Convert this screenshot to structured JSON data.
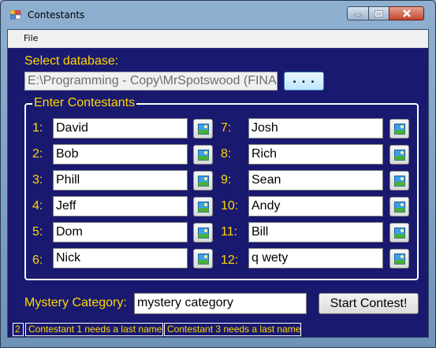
{
  "window": {
    "title": "Contestants"
  },
  "menu": {
    "file": "File"
  },
  "database": {
    "label": "Select database:",
    "path": "E:\\Programming - Copy\\MrSpotswood (FINA",
    "browse_label": ". . ."
  },
  "contestants": {
    "group_title": "Enter Contestants",
    "left": [
      {
        "number": "1:",
        "name": "David"
      },
      {
        "number": "2:",
        "name": "Bob"
      },
      {
        "number": "3:",
        "name": "Phill"
      },
      {
        "number": "4:",
        "name": "Jeff"
      },
      {
        "number": "5:",
        "name": "Dom"
      },
      {
        "number": "6:",
        "name": "Nick"
      }
    ],
    "right": [
      {
        "number": "7:",
        "name": "Josh"
      },
      {
        "number": "8:",
        "name": "Rich"
      },
      {
        "number": "9:",
        "name": "Sean"
      },
      {
        "number": "10:",
        "name": "Andy"
      },
      {
        "number": "11:",
        "name": "Bill"
      },
      {
        "number": "12:",
        "name": "q wety"
      }
    ],
    "image_button_icon": "picture-icon"
  },
  "mystery": {
    "label": "Mystery Category:",
    "value": "mystery category"
  },
  "start_button": "Start Contest!",
  "status": {
    "count": "2",
    "messages": [
      "Contestant 1 needs a last name",
      "Contestant 3 needs a last name"
    ]
  },
  "colors": {
    "background": "#191970",
    "label": "#ffd700"
  }
}
